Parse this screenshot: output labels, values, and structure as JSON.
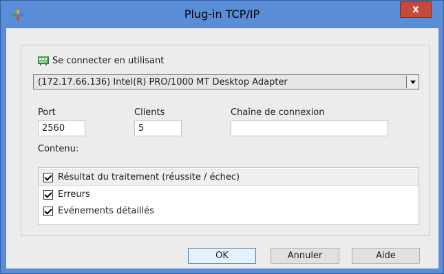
{
  "window": {
    "title": "Plug-in TCP/IP",
    "close_label": "x"
  },
  "connection": {
    "group_label": "Se connecter en utilisant",
    "adapter_selected": "(172.17.66.136) Intel(R) PRO/1000 MT Desktop Adapter"
  },
  "fields": {
    "port_label": "Port",
    "port_value": "2560",
    "clients_label": "Clients",
    "clients_value": "5",
    "connstr_label": "Chaîne de connexion",
    "connstr_value": ""
  },
  "content": {
    "label": "Contenu:",
    "items": [
      {
        "label": "Résultat du traitement (réussite / échec)",
        "checked": true
      },
      {
        "label": "Erreurs",
        "checked": true
      },
      {
        "label": "Evénements détaillés",
        "checked": true
      }
    ]
  },
  "buttons": {
    "ok": "OK",
    "cancel": "Annuler",
    "help": "Aide"
  },
  "colors": {
    "titlebar": "#5b8dd6",
    "close": "#c7493a",
    "client": "#ececec"
  }
}
